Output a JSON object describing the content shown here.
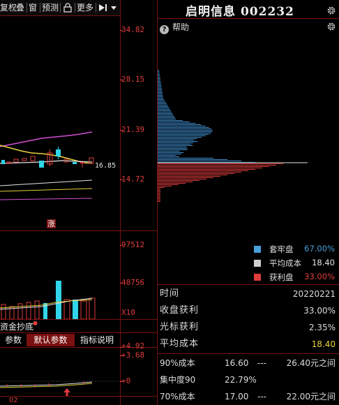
{
  "toolbar": {
    "items": [
      "复权",
      "叠",
      "窗",
      "预测",
      "更多"
    ],
    "lock_icon": "lock-icon",
    "arrow_icon": "play-to-end-icon",
    "dropdown_icon": "chevron-down-icon"
  },
  "price_axis": [
    "34.82",
    "28.15",
    "21.39",
    "14.72"
  ],
  "current_price_label": "16.85",
  "chart_marker": "涨",
  "volume_axis": [
    "97512",
    "48756"
  ],
  "volume_unit": "X10",
  "indicator": {
    "name": "资金抄底",
    "axis": [
      "+4.92",
      "+3.68",
      "+0"
    ],
    "date_label": "02"
  },
  "tabs": {
    "params": "参数",
    "default_params": "默认参数",
    "indicator_help": "指标说明"
  },
  "chip_panel": {
    "title": "启明信息 002232",
    "help": "帮助",
    "legend": [
      {
        "label": "套牢盘",
        "value": "67.00%",
        "color": "#4a9fd8"
      },
      {
        "label": "平均成本",
        "value": "18.40",
        "color": "#d0d0d0"
      },
      {
        "label": "获利盘",
        "value": "33.00%",
        "color": "#e03c3c"
      }
    ],
    "info": [
      {
        "key": "时间",
        "value": "20220221"
      },
      {
        "key": "收盘获利",
        "value": "33.00%"
      },
      {
        "key": "光标获利",
        "value": "2.35%"
      },
      {
        "key": "平均成本",
        "value": "18.40"
      }
    ],
    "cost_rows": [
      {
        "label": "90%成本",
        "low": "16.60",
        "sep": "---",
        "high": "26.40元之间"
      },
      {
        "label": "集中度90",
        "low": "22.79%",
        "sep": "",
        "high": ""
      },
      {
        "label": "70%成本",
        "low": "17.00",
        "sep": "---",
        "high": "22.00元之间"
      }
    ]
  },
  "colors": {
    "up": "#e03c3c",
    "down": "#31d4e8",
    "ma_white": "#e6e6e6",
    "ma_yellow": "#e6d23c",
    "ma_magenta": "#d24fd2",
    "chip_blue": "#3f8fd0",
    "chip_red": "#e03c3c",
    "grid": "#7a1010"
  }
}
